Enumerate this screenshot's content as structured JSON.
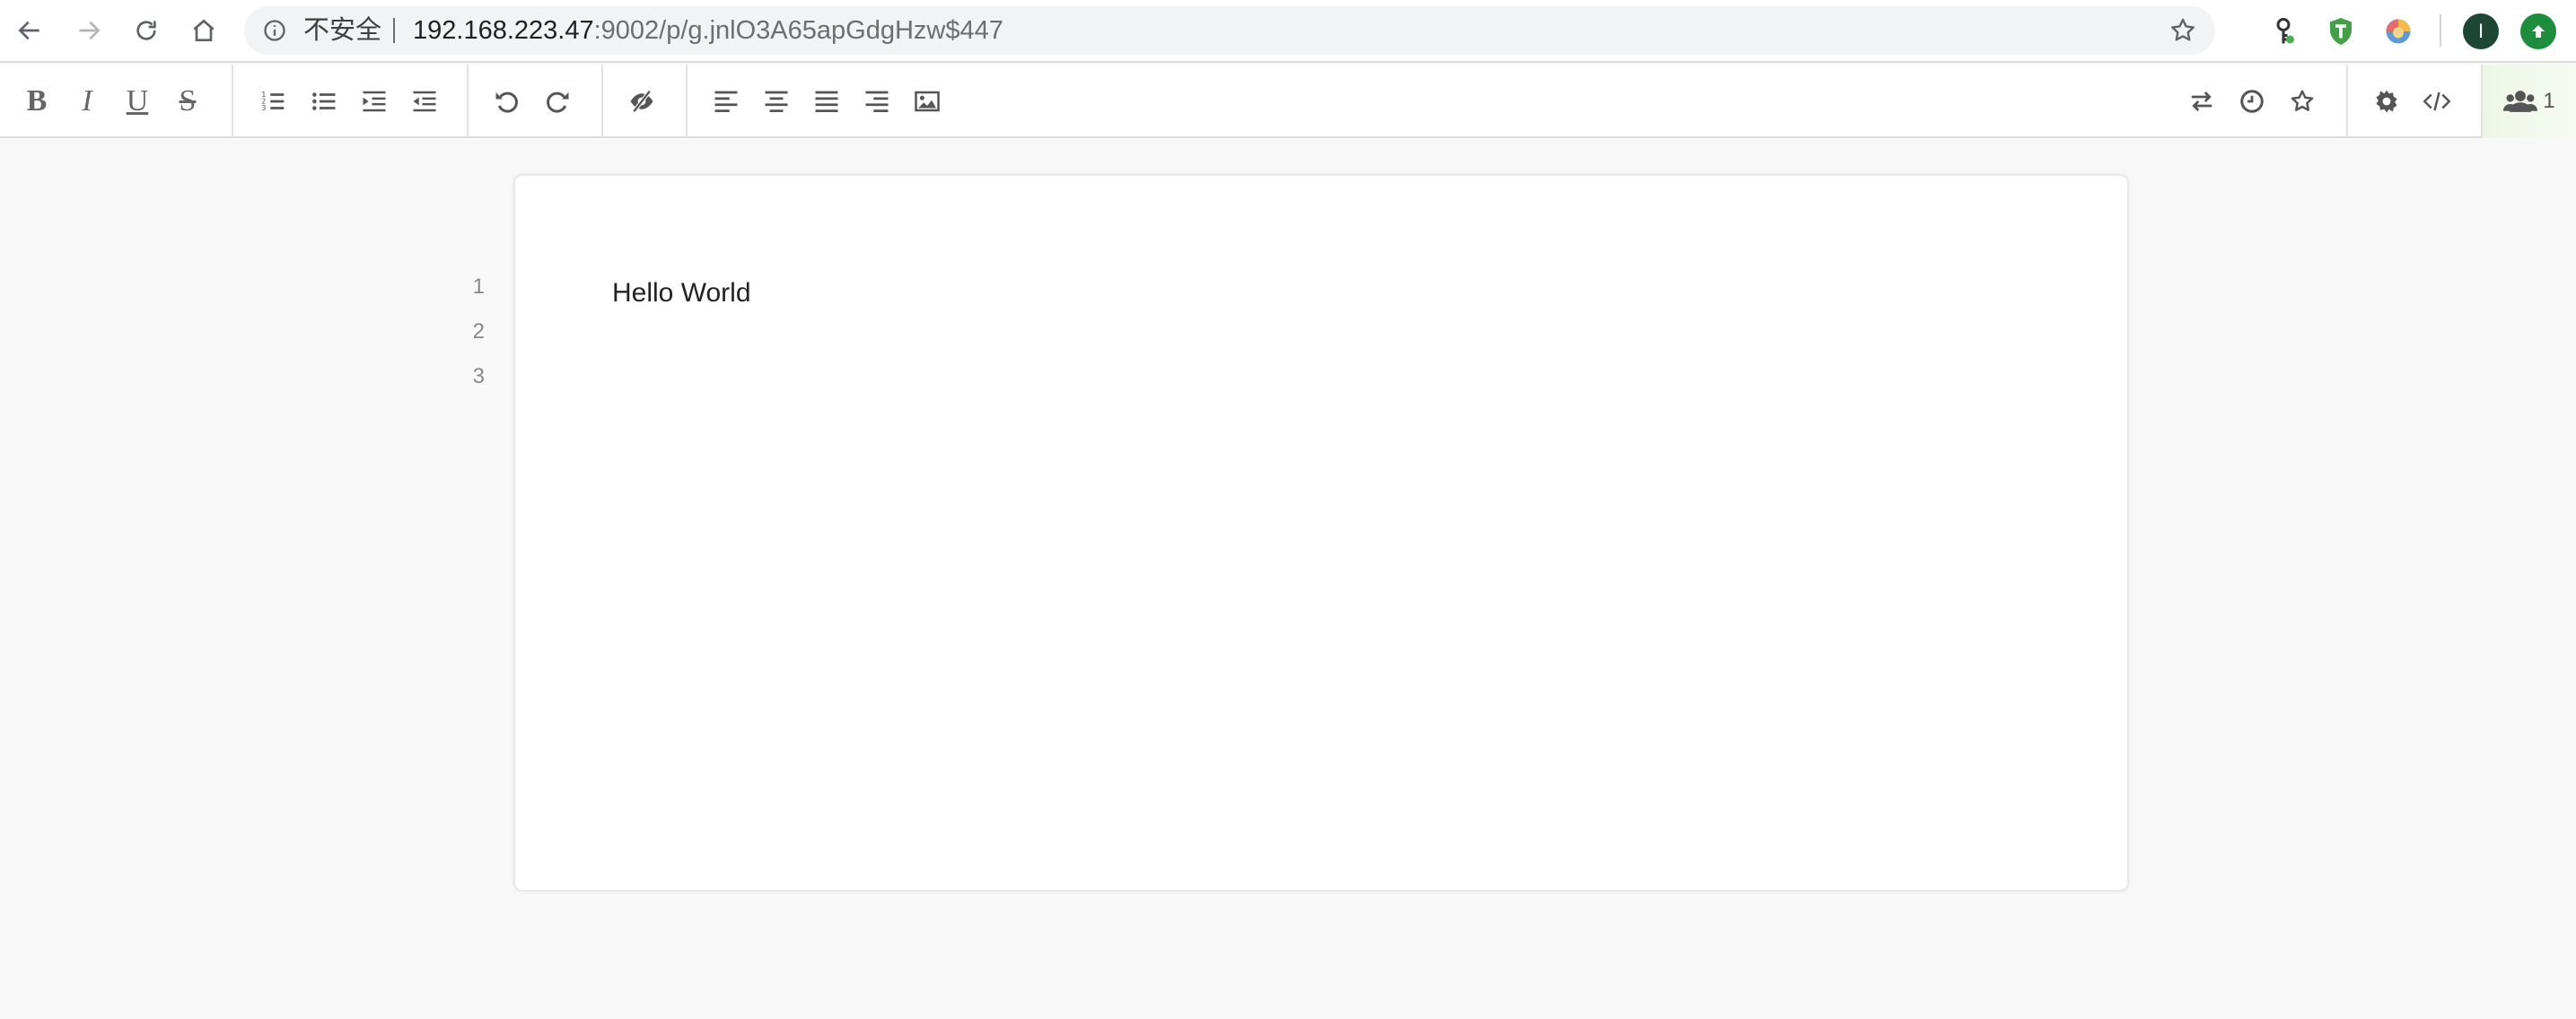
{
  "browser": {
    "insecure_label": "不安全",
    "url_host": "192.168.223.47",
    "url_path": ":9002/p/g.jnlO3A65apGdgHzw$447",
    "profile_initial": "I",
    "icons": [
      "back-icon",
      "forward-icon",
      "reload-icon",
      "home-icon",
      "info-icon",
      "bookmark-star-icon"
    ],
    "extensions": [
      "key-extension-icon",
      "t-shield-extension-icon",
      "colorful-extension-icon"
    ]
  },
  "toolbar": {
    "bold": "B",
    "italic": "I",
    "underline": "U",
    "strike": "S",
    "user_count": "1",
    "accent": "#f3f9ee"
  },
  "document": {
    "line_numbers": [
      "1",
      "2",
      "3"
    ],
    "lines": [
      "Hello World",
      "",
      ""
    ]
  }
}
